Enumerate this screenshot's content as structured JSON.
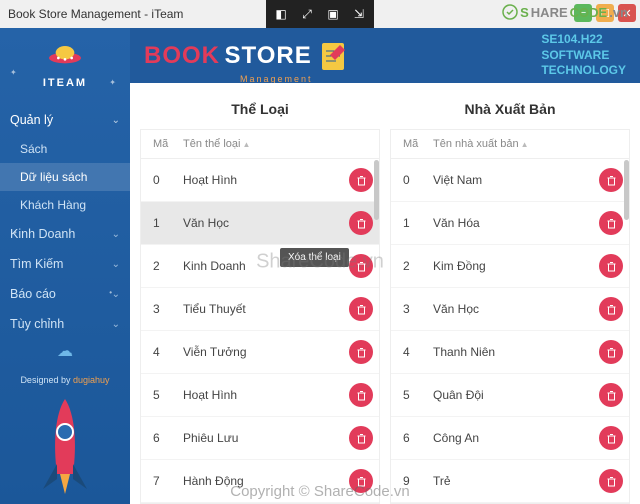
{
  "window": {
    "title": "Book Store Management - iTeam"
  },
  "sharecode": {
    "s": "S",
    "hare": "HARE",
    "code": "CODE",
    "tld": ".vn"
  },
  "sidebar": {
    "logo": "ITEAM",
    "groups": [
      {
        "label": "Quản lý",
        "expanded": true,
        "items": [
          "Sách",
          "Dữ liệu sách",
          "Khách Hàng"
        ],
        "active": 1
      },
      {
        "label": "Kinh Doanh",
        "expanded": false
      },
      {
        "label": "Tìm Kiếm",
        "expanded": false
      },
      {
        "label": "Báo cáo",
        "expanded": false
      },
      {
        "label": "Tùy chỉnh",
        "expanded": false
      }
    ],
    "credit_by": "Designed by",
    "credit_name": "dugiahuy"
  },
  "header": {
    "book": "BOOK",
    "store": "STORE",
    "sub": "Management",
    "right": [
      "SE104.H22",
      "SOFTWARE",
      "TECHNOLOGY"
    ]
  },
  "panels": {
    "left": {
      "title": "Thể Loại",
      "cols": [
        "Mã",
        "Tên thể loại"
      ],
      "rows": [
        {
          "id": "0",
          "name": "Hoạt Hình"
        },
        {
          "id": "1",
          "name": "Văn Học"
        },
        {
          "id": "2",
          "name": "Kinh Doanh"
        },
        {
          "id": "3",
          "name": "Tiểu Thuyết"
        },
        {
          "id": "4",
          "name": "Viễn Tưởng"
        },
        {
          "id": "5",
          "name": "Hoạt Hình"
        },
        {
          "id": "6",
          "name": "Phiêu Lưu"
        },
        {
          "id": "7",
          "name": "Hành Động"
        }
      ],
      "hover": 1
    },
    "right": {
      "title": "Nhà Xuất Bản",
      "cols": [
        "Mã",
        "Tên nhà xuất bản"
      ],
      "rows": [
        {
          "id": "0",
          "name": "Việt Nam"
        },
        {
          "id": "1",
          "name": "Văn Hóa"
        },
        {
          "id": "2",
          "name": "Kim Đồng"
        },
        {
          "id": "3",
          "name": "Văn Học"
        },
        {
          "id": "4",
          "name": "Thanh Niên"
        },
        {
          "id": "5",
          "name": "Quân Đội"
        },
        {
          "id": "6",
          "name": "Công An"
        },
        {
          "id": "9",
          "name": "Trẻ"
        }
      ]
    }
  },
  "tooltip": "Xóa thể loại",
  "watermark_center": "ShareCode.vn",
  "watermark_bottom": "Copyright © ShareCode.vn"
}
